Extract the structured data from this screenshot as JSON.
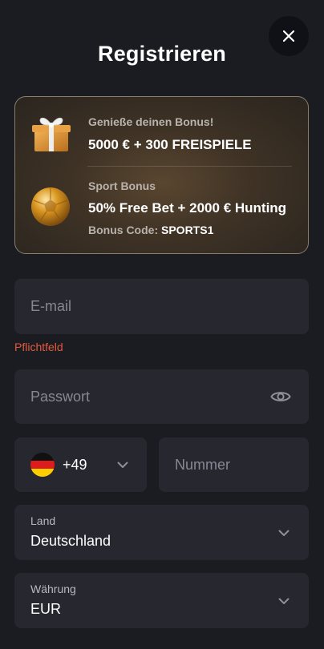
{
  "header": {
    "title": "Registrieren",
    "close_icon": "close-icon"
  },
  "bonus": {
    "items": [
      {
        "icon": "gift-box-icon",
        "label": "Genieße deinen Bonus!",
        "value": "5000 € + 300 FREISPIELE"
      },
      {
        "icon": "golden-football-icon",
        "label": "Sport Bonus",
        "value": "50% Free Bet + 2000 € Hunting",
        "code_label": "Bonus Code:",
        "code": "SPORTS1"
      }
    ]
  },
  "form": {
    "email": {
      "placeholder": "E-mail",
      "error": "Pflichtfeld"
    },
    "password": {
      "placeholder": "Passwort",
      "icon": "eye-icon"
    },
    "phone": {
      "country_icon": "germany-flag-icon",
      "code": "+49",
      "placeholder": "Nummer"
    },
    "country": {
      "label": "Land",
      "value": "Deutschland"
    },
    "currency": {
      "label": "Währung",
      "value": "EUR"
    }
  },
  "colors": {
    "background": "#1b1c22",
    "field": "#26272f",
    "error": "#e35a3c",
    "card_border": "#8a7d6a"
  }
}
